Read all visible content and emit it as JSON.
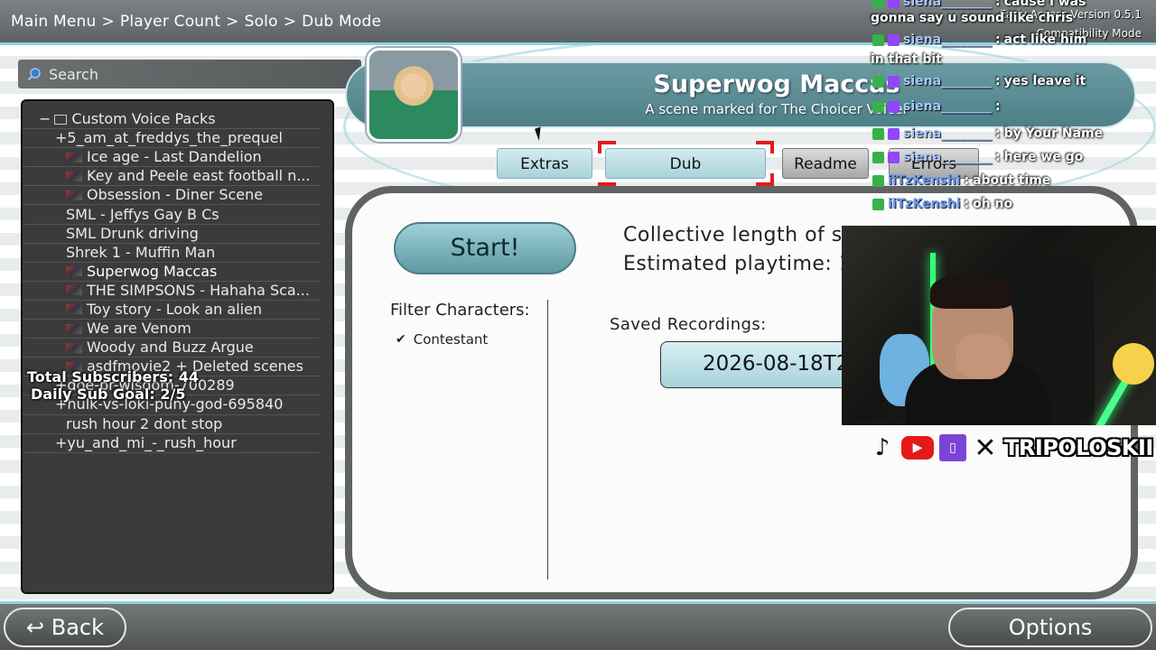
{
  "breadcrumb": [
    "Main Menu",
    "Player Count",
    "Solo",
    "Dub Mode"
  ],
  "breadcrumb_sep": ">",
  "search": {
    "placeholder": "Search"
  },
  "tree": {
    "root_label": "Custom Voice Packs",
    "items": [
      {
        "label": "5_am_at_freddys_the_prequel",
        "prefix": "+",
        "thumb": false
      },
      {
        "label": "Ice age - Last Dandelion",
        "prefix": "",
        "thumb": true
      },
      {
        "label": "Key and Peele east football n...",
        "prefix": "",
        "thumb": true
      },
      {
        "label": "Obsession - Diner Scene",
        "prefix": "",
        "thumb": true
      },
      {
        "label": "SML - Jeffys Gay B Cs",
        "prefix": "",
        "thumb": false
      },
      {
        "label": "SML Drunk driving",
        "prefix": "",
        "thumb": false
      },
      {
        "label": "Shrek 1 - Muffin Man",
        "prefix": "",
        "thumb": false
      },
      {
        "label": "Superwog Maccas",
        "prefix": "",
        "thumb": true,
        "selected": true
      },
      {
        "label": "THE SIMPSONS - Hahaha Sca...",
        "prefix": "",
        "thumb": true
      },
      {
        "label": "Toy story - Look an alien",
        "prefix": "",
        "thumb": true
      },
      {
        "label": "We are Venom",
        "prefix": "",
        "thumb": true
      },
      {
        "label": "Woody and Buzz Argue",
        "prefix": "",
        "thumb": true
      },
      {
        "label": "asdfmovie2 + Deleted scenes",
        "prefix": "",
        "thumb": true
      },
      {
        "label": "doe-pr-wisdom-700289",
        "prefix": "+",
        "thumb": false
      },
      {
        "label": "hulk-vs-loki-puny-god-695840",
        "prefix": "+",
        "thumb": false
      },
      {
        "label": "rush hour 2 dont stop",
        "prefix": "",
        "thumb": false
      },
      {
        "label": "yu_and_mi_-_rush_hour",
        "prefix": "+",
        "thumb": false
      }
    ]
  },
  "overlay": {
    "total_subs": "Total Subscribers: 44",
    "daily_goal": "Daily Sub Goal: 2/5"
  },
  "pack": {
    "title": "Superwog Maccas",
    "subtitle": "A scene marked for The Choicer Voicer"
  },
  "tabs": {
    "extras": "Extras",
    "dub": "Dub",
    "readme": "Readme",
    "errors": "Errors"
  },
  "main": {
    "start_label": "Start!",
    "collective_length": "Collective length of s",
    "estimated_playtime": "Estimated playtime: 1",
    "filter_title": "Filter Characters:",
    "filter_items": [
      {
        "label": "Contestant",
        "checked": true
      }
    ],
    "saved_title": "Saved Recordings:",
    "recording": "2026-08-18T2"
  },
  "chat": [
    {
      "user": "siena________",
      "msg": "cause i was",
      "badges": [
        "green",
        "purple"
      ]
    },
    {
      "user": "",
      "msg": "gonna say u sound like chris",
      "badges": []
    },
    {
      "user": "siena________",
      "msg": "act like him",
      "badges": [
        "green",
        "purple"
      ]
    },
    {
      "user": "",
      "msg": "in that bit",
      "badges": []
    },
    {
      "user": "siena________",
      "msg": "yes leave it",
      "badges": [
        "green",
        "purple"
      ]
    },
    {
      "user": "siena________",
      "msg": "",
      "badges": [
        "green",
        "purple"
      ]
    },
    {
      "user": "siena________",
      "msg": "by Your Name",
      "badges": [
        "green",
        "purple"
      ]
    },
    {
      "user": "siena________",
      "msg": "here we go",
      "badges": [
        "green",
        "purple"
      ]
    },
    {
      "user": "iiTzKenshi",
      "msg": "about time",
      "badges": [
        "green"
      ]
    },
    {
      "user": "iiTzKenshi",
      "msg": "oh no",
      "badges": [
        "green"
      ]
    }
  ],
  "version": {
    "line1": "Early Access Version 0.5.1",
    "line2": "Compatibility Mode"
  },
  "socials": {
    "handle": "TRIPOLOSKII",
    "icons": [
      "tiktok-icon",
      "youtube-icon",
      "twitch-icon",
      "x-icon"
    ]
  },
  "bottom": {
    "back_label": "Back",
    "options_label": "Options"
  },
  "colors": {
    "accent": "#8fd3e0",
    "tab_teal": "#a9d3da",
    "selection_red": "#e01d1d",
    "panel_dark": "#3b3b3b"
  }
}
